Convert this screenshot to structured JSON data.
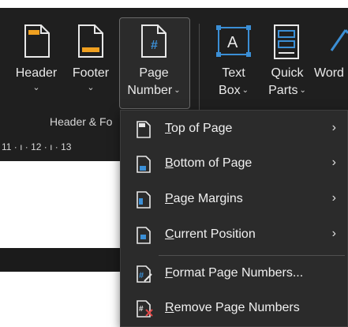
{
  "ribbon": {
    "header": {
      "label": "Header",
      "chevron": "⌄"
    },
    "footer": {
      "label": "Footer",
      "chevron": "⌄"
    },
    "page_number": {
      "line1": "Page",
      "line2": "Number",
      "chevron": "⌄"
    },
    "text_box": {
      "line1": "Text",
      "line2": "Box",
      "chevron": "⌄"
    },
    "quick_parts": {
      "line1": "Quick",
      "line2": "Parts",
      "chevron": "⌄"
    },
    "wordart": {
      "line1": "Word"
    },
    "group_label": "Header & Fo"
  },
  "ruler": {
    "text": "11 · ı · 12 · ı · 13"
  },
  "menu": {
    "items": [
      {
        "first": "T",
        "rest": "op of Page",
        "arrow": "›"
      },
      {
        "first": "B",
        "rest": "ottom of Page",
        "arrow": "›"
      },
      {
        "first": "P",
        "rest": "age Margins",
        "arrow": "›"
      },
      {
        "first": "C",
        "rest": "urrent Position",
        "arrow": "›"
      },
      {
        "first": "F",
        "rest": "ormat Page Numbers...",
        "arrow": ""
      },
      {
        "first": "R",
        "rest": "emove Page Numbers",
        "arrow": ""
      }
    ]
  },
  "colors": {
    "ribbon_bg": "#1f1f1f",
    "menu_bg": "#2b2b2b",
    "accent_blue": "#3b8fd6",
    "accent_orange": "#f0a020"
  },
  "icons": {
    "header": "header-page-icon",
    "footer": "footer-page-icon",
    "page_number": "page-number-icon",
    "text_box": "text-box-icon",
    "quick_parts": "quick-parts-icon",
    "wordart": "wordart-icon"
  }
}
